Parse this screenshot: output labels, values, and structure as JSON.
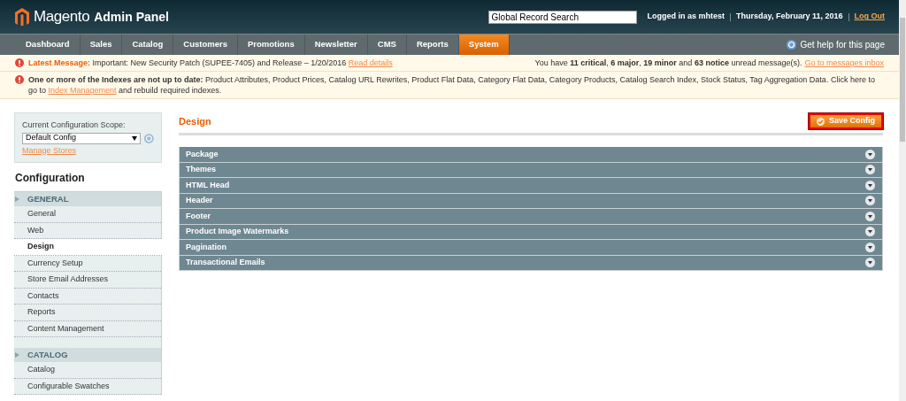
{
  "header": {
    "logo": "Magento",
    "logo_suffix": "Admin Panel",
    "search": {
      "value": "Global Record Search"
    },
    "logged_in": "Logged in as mhtest",
    "date": "Thursday, February 11, 2016",
    "logout": "Log Out"
  },
  "nav": {
    "items": [
      {
        "label": "Dashboard",
        "selected": false
      },
      {
        "label": "Sales",
        "selected": false
      },
      {
        "label": "Catalog",
        "selected": false
      },
      {
        "label": "Customers",
        "selected": false
      },
      {
        "label": "Promotions",
        "selected": false
      },
      {
        "label": "Newsletter",
        "selected": false
      },
      {
        "label": "CMS",
        "selected": false
      },
      {
        "label": "Reports",
        "selected": false
      },
      {
        "label": "System",
        "selected": true
      }
    ],
    "help": "Get help for this page"
  },
  "messages": [
    {
      "label": "Latest Message:",
      "text": "Important: New Security Patch (SUPEE-7405) and Release – 1/20/2016",
      "link": "Read details",
      "summary": "You have **11 critical**, **6 major**, **19 minor** and **63 notice** unread message(s).",
      "summary_link": "Go to messages inbox"
    },
    {
      "label": "One or more of the Indexes are not up to date:",
      "text": "Product Attributes, Product Prices, Catalog URL Rewrites, Product Flat Data, Category Flat Data, Category Products, Catalog Search Index, Stock Status, Tag Aggregation Data. Click here to go to",
      "link": "Index Management",
      "after": "and rebuild required indexes."
    }
  ],
  "sidebar": {
    "scope_label": "Current Configuration Scope:",
    "scope": {
      "value": "Default Config"
    },
    "manage_stores": "Manage Stores",
    "title": "Configuration",
    "sections": [
      {
        "label": "GENERAL",
        "items": [
          {
            "label": "General",
            "selected": false
          },
          {
            "label": "Web",
            "selected": false
          },
          {
            "label": "Design",
            "selected": true
          },
          {
            "label": "Currency Setup",
            "selected": false
          },
          {
            "label": "Store Email Addresses",
            "selected": false
          },
          {
            "label": "Contacts",
            "selected": false
          },
          {
            "label": "Reports",
            "selected": false
          },
          {
            "label": "Content Management",
            "selected": false
          }
        ]
      },
      {
        "label": "CATALOG",
        "items": [
          {
            "label": "Catalog",
            "selected": false
          },
          {
            "label": "Configurable Swatches",
            "selected": false
          }
        ]
      }
    ]
  },
  "main": {
    "title": "Design",
    "save_button": "Save Config",
    "groups": [
      {
        "label": "Package",
        "expanded": false
      },
      {
        "label": "Themes",
        "expanded": false
      },
      {
        "label": "HTML Head",
        "expanded": false
      },
      {
        "label": "Header",
        "expanded": false
      },
      {
        "label": "Footer",
        "expanded": false
      },
      {
        "label": "Product Image Watermarks",
        "expanded": false
      },
      {
        "label": "Pagination",
        "expanded": false
      },
      {
        "label": "Transactional Emails",
        "expanded": false
      }
    ]
  }
}
